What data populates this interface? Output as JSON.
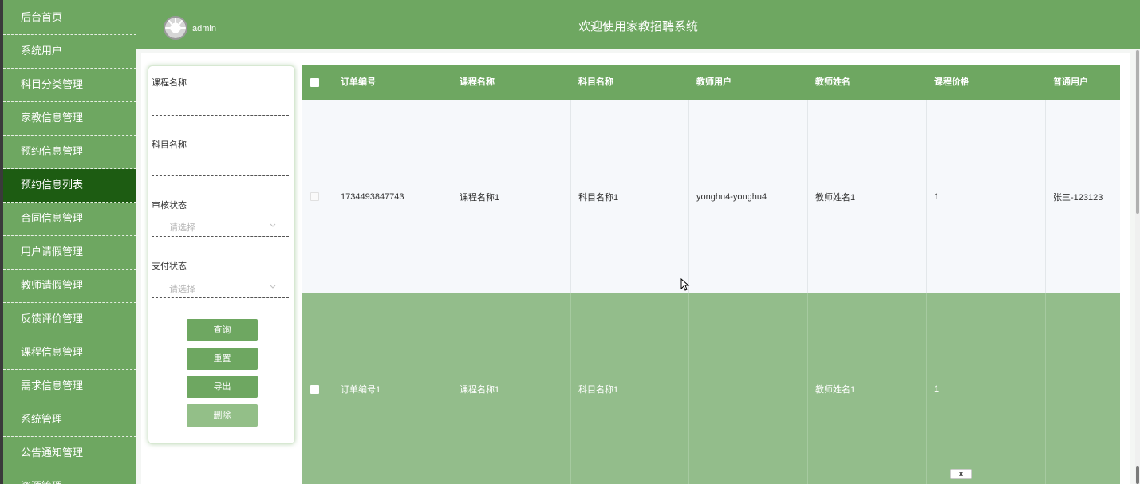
{
  "sidebar": {
    "items": [
      {
        "label": "后台首页",
        "active": false
      },
      {
        "label": "系统用户",
        "active": false
      },
      {
        "label": "科目分类管理",
        "active": false
      },
      {
        "label": "家教信息管理",
        "active": false
      },
      {
        "label": "预约信息管理",
        "active": false
      },
      {
        "label": "预约信息列表",
        "active": true
      },
      {
        "label": "合同信息管理",
        "active": false
      },
      {
        "label": "用户请假管理",
        "active": false
      },
      {
        "label": "教师请假管理",
        "active": false
      },
      {
        "label": "反馈评价管理",
        "active": false
      },
      {
        "label": "课程信息管理",
        "active": false
      },
      {
        "label": "需求信息管理",
        "active": false
      },
      {
        "label": "系统管理",
        "active": false
      },
      {
        "label": "公告通知管理",
        "active": false
      },
      {
        "label": "资源管理",
        "active": false
      }
    ]
  },
  "header": {
    "username": "admin",
    "title": "欢迎使用家教招聘系统"
  },
  "filter": {
    "course_name_label": "课程名称",
    "subject_name_label": "科目名称",
    "review_status_label": "审核状态",
    "review_status_placeholder": "请选择",
    "pay_status_label": "支付状态",
    "pay_status_placeholder": "请选择",
    "query_button": "查询",
    "reset_button": "重置",
    "export_button": "导出",
    "delete_button": "删除"
  },
  "table": {
    "columns": [
      "订单编号",
      "课程名称",
      "科目名称",
      "教师用户",
      "教师姓名",
      "课程价格",
      "普通用户"
    ],
    "rows": [
      [
        "1734493847743",
        "课程名称1",
        "科目名称1",
        "yonghu4-yonghu4",
        "教师姓名1",
        "1",
        "张三-123123"
      ],
      [
        "订单编号1",
        "课程名称1",
        "科目名称1",
        "",
        "教师姓名1",
        "1",
        ""
      ]
    ]
  },
  "popup": {
    "close_label": "x"
  },
  "colors": {
    "sidebar": "#6ea761",
    "sidebar_active": "#1d5c12",
    "header": "#6ea761",
    "row_selected": "#93bd8b"
  }
}
